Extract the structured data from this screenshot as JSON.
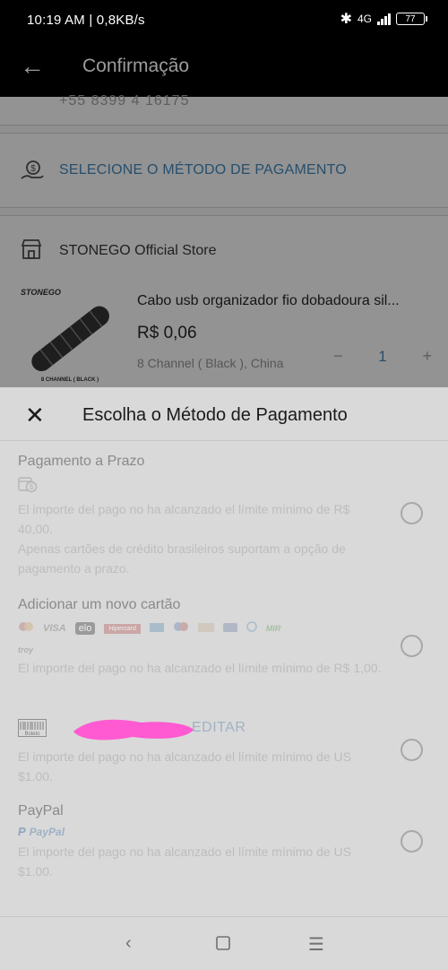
{
  "status": {
    "time": "10:19 AM | 0,8KB/s",
    "network": "4G",
    "battery": "77"
  },
  "appbar": {
    "title": "Confirmação"
  },
  "address": {
    "phone_partial": "+55 8399 4 16175"
  },
  "payment_row": {
    "label": "SELECIONE O MÉTODO DE PAGAMENTO"
  },
  "store": {
    "name": "STONEGO Official Store"
  },
  "product": {
    "brand_logo": "STONEGO",
    "image_caption": "8 CHANNEL ( BLACK )",
    "title": "Cabo usb organizador fio dobadoura sil...",
    "price": "R$ 0,06",
    "variant": "8 Channel ( Black ), China",
    "qty": "1",
    "minus": "−",
    "plus": "+"
  },
  "sheet": {
    "title": "Escolha o Método de Pagamento",
    "options": [
      {
        "name": "Pagamento a Prazo",
        "msg1": "El importe del pago no ha alcanzado el límite mínimo de R$ 40,00.",
        "msg2": "Apenas cartões de crédito brasileiros suportam a opção de pagamento a prazo."
      },
      {
        "name": "Adicionar um novo cartão",
        "logos": [
          "VISA",
          "elo",
          "Hipercard",
          "MIR",
          "troy"
        ],
        "msg1": "El importe del pago no ha alcanzado el límite mínimo de R$ 1,00."
      },
      {
        "name": "Boleto",
        "action": "EDITAR",
        "msg1": "El importe del pago no ha alcanzado el límite mínimo de US $1.00."
      },
      {
        "name": "PayPal",
        "logo_text": "PayPal",
        "msg1": "El importe del pago no ha alcanzado el límite mínimo de US $1.00."
      }
    ]
  },
  "icons": [
    "back-arrow-icon",
    "payment-hand-icon",
    "store-icon",
    "close-icon",
    "calendar-dollar-icon",
    "boleto-barcode-icon",
    "paypal-icon",
    "nav-back-icon",
    "nav-home-icon",
    "nav-menu-icon"
  ],
  "colors": {
    "link": "#264f6e",
    "redaction": "#ff5ad2"
  }
}
